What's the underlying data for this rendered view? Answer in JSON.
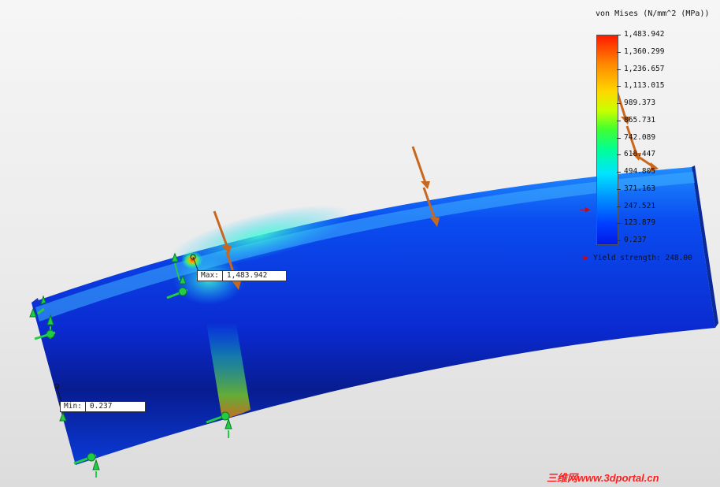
{
  "legend": {
    "title": "von Mises (N/mm^2 (MPa))",
    "ticks": [
      "1,483.942",
      "1,360.299",
      "1,236.657",
      "1,113.015",
      "989.373",
      "865.731",
      "742.089",
      "618.447",
      "494.805",
      "371.163",
      "247.521",
      "123.879",
      "0.237"
    ],
    "yield_label": "Yield strength: 248.00"
  },
  "probes": {
    "max": {
      "label": "Max:",
      "value": "1,483.942"
    },
    "min": {
      "label": "Min:",
      "value": "0.237"
    }
  },
  "watermark": "三维网www.3dportal.cn",
  "colors": {
    "background": "#eeeeee",
    "load_arrow": "#d2691e",
    "fixture": "#22cc44",
    "yield_marker": "#e00000",
    "accent_blue": "#0018e8"
  },
  "icons": [
    "load-arrow-icon",
    "fixture-icon",
    "yield-arrow-icon",
    "probe-marker-icon"
  ]
}
